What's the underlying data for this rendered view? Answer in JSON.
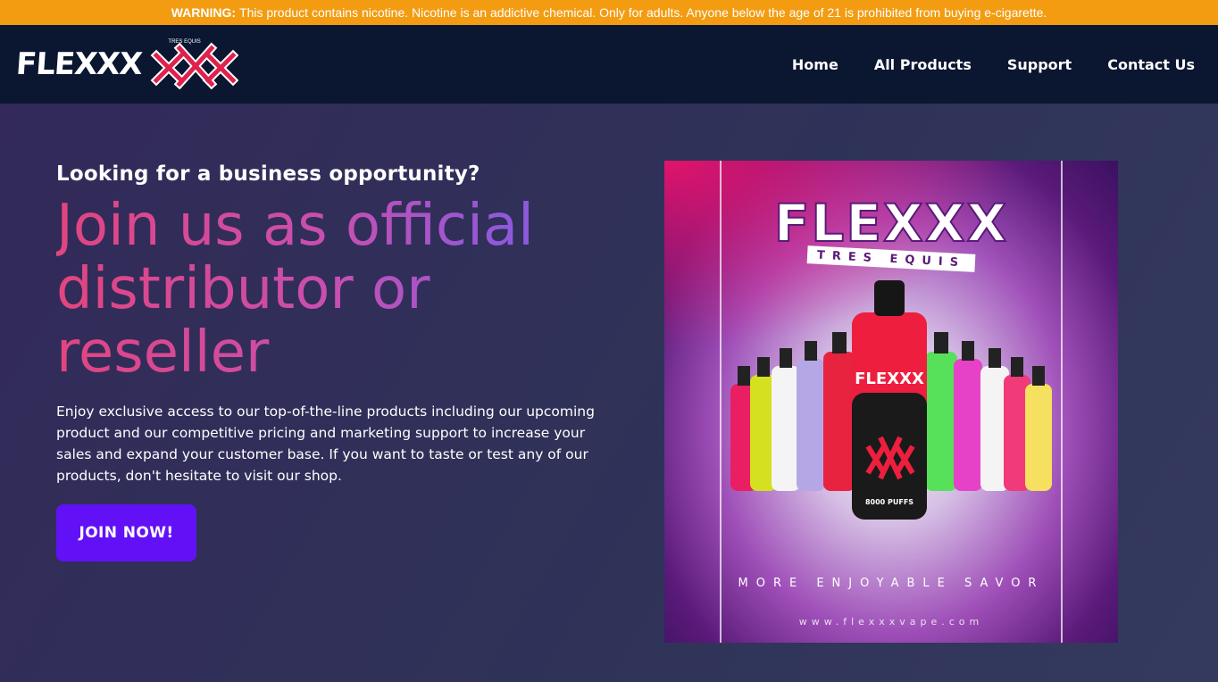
{
  "warning": {
    "label": "WARNING:",
    "text": "This product contains nicotine. Nicotine is an addictive chemical. Only for adults. Anyone below the age of 21 is prohibited from buying e-cigarette."
  },
  "header": {
    "logo_text": "FLEXXX",
    "logo_tag": "TRES EQUIS",
    "nav": [
      {
        "label": "Home"
      },
      {
        "label": "All Products"
      },
      {
        "label": "Support"
      },
      {
        "label": "Contact Us"
      }
    ]
  },
  "hero": {
    "eyebrow": "Looking for a business opportunity?",
    "headline": "Join us as official distributor or reseller",
    "body": "Enjoy exclusive access to our top-of-the-line products including our upcoming product and our competitive pricing and marketing support to increase your sales and expand your customer base. If you want to taste or test any of our products, don't hesitate to visit our shop.",
    "cta_label": "JOIN NOW!"
  },
  "poster": {
    "brand": "FLEXXX",
    "sub": "TRES EQUIS",
    "bottle_label": "FLEXXX",
    "bottle_puffs": "8000 PUFFS",
    "tagline": "MORE ENJOYABLE SAVOR",
    "website": "www.flexxxvape.com"
  },
  "colors": {
    "warning_bg": "#f39c12",
    "nav_bg": "#0b1631",
    "cta_bg": "#6211f7",
    "headline_gradient": [
      "#e2457f",
      "#8f59dc"
    ]
  }
}
